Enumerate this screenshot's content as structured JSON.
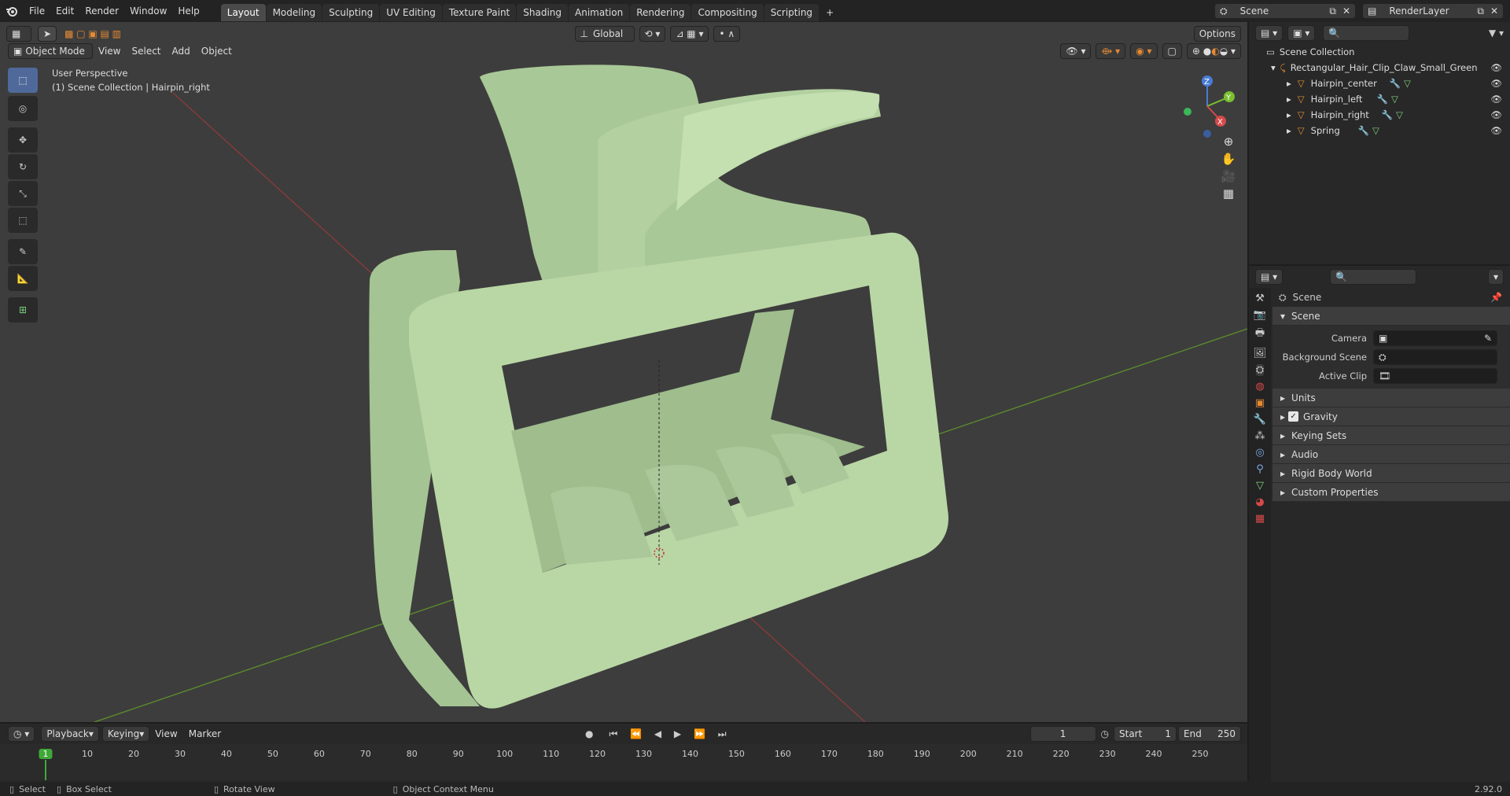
{
  "topbar": {
    "menus": [
      "File",
      "Edit",
      "Render",
      "Window",
      "Help"
    ],
    "workspaces": [
      "Layout",
      "Modeling",
      "Sculpting",
      "UV Editing",
      "Texture Paint",
      "Shading",
      "Animation",
      "Rendering",
      "Compositing",
      "Scripting"
    ],
    "active_workspace": "Layout",
    "add_tab": "+",
    "scene": "Scene",
    "view_layer": "RenderLayer"
  },
  "viewport": {
    "orientation": "Global",
    "options": "Options",
    "mode": "Object Mode",
    "menus": [
      "View",
      "Select",
      "Add",
      "Object"
    ],
    "info_line1": "User Perspective",
    "info_line2": "(1) Scene Collection | Hairpin_right",
    "gizmo": {
      "x": "X",
      "y": "Y",
      "z": "Z"
    },
    "model_color": "#b9d7a5",
    "bg_color": "#3d3d3d"
  },
  "outliner": {
    "root": "Scene Collection",
    "collection": "Rectangular_Hair_Clip_Claw_Small_Green",
    "objects": [
      "Hairpin_center",
      "Hairpin_left",
      "Hairpin_right",
      "Spring"
    ]
  },
  "properties": {
    "header": "Scene",
    "panel": "Scene",
    "fields": [
      {
        "label": "Camera"
      },
      {
        "label": "Background Scene"
      },
      {
        "label": "Active Clip"
      }
    ],
    "subpanels": [
      "Units",
      "Gravity",
      "Keying Sets",
      "Audio",
      "Rigid Body World",
      "Custom Properties"
    ],
    "gravity_checked": true
  },
  "timeline": {
    "menus": [
      "Playback",
      "Keying",
      "View",
      "Marker"
    ],
    "current_frame": "1",
    "start_label": "Start",
    "start": "1",
    "end_label": "End",
    "end": "250",
    "ticks": [
      "1",
      "10",
      "20",
      "30",
      "40",
      "50",
      "60",
      "70",
      "80",
      "90",
      "100",
      "110",
      "120",
      "130",
      "140",
      "150",
      "160",
      "170",
      "180",
      "190",
      "200",
      "210",
      "220",
      "230",
      "240",
      "250"
    ]
  },
  "status": {
    "select": "Select",
    "box_select": "Box Select",
    "rotate": "Rotate View",
    "context": "Object Context Menu",
    "version": "2.92.0"
  },
  "colors": {
    "accent": "#4a72b5",
    "orange": "#e58a34",
    "active_frame": "#3fa838"
  }
}
